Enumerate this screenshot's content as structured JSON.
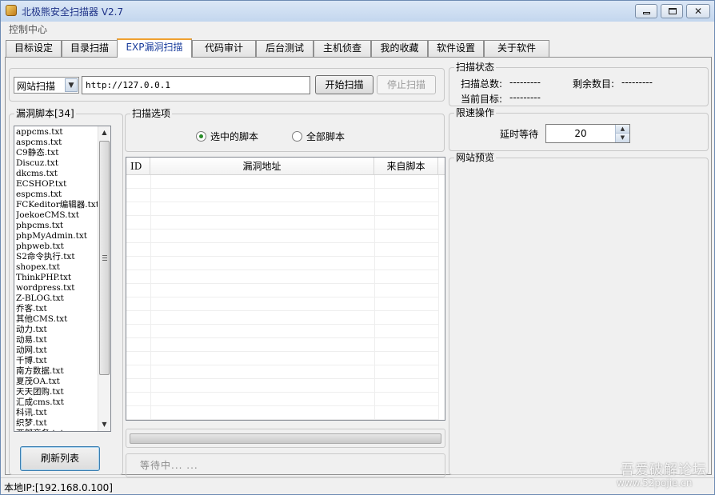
{
  "window": {
    "title": "北极熊安全扫描器 V2.7",
    "buttons": {
      "min": "minimize",
      "max": "maximize",
      "close": "✕"
    }
  },
  "menu": {
    "control_center": "控制中心"
  },
  "tabs": [
    {
      "label": "目标设定"
    },
    {
      "label": "目录扫描"
    },
    {
      "label": "EXP漏洞扫描"
    },
    {
      "label": "代码审计"
    },
    {
      "label": "后台测试"
    },
    {
      "label": "主机侦查"
    },
    {
      "label": "我的收藏"
    },
    {
      "label": "软件设置"
    },
    {
      "label": "关于软件"
    }
  ],
  "active_tab": 2,
  "scan_bar": {
    "mode_value": "网站扫描",
    "url_value": "http://127.0.0.1",
    "start_label": "开始扫描",
    "stop_label": "停止扫描"
  },
  "script_list": {
    "title": "漏洞脚本[34]",
    "items": [
      "appcms.txt",
      "aspcms.txt",
      "C9静态.txt",
      "Discuz.txt",
      "dkcms.txt",
      "ECSHOP.txt",
      "espcms.txt",
      "FCKeditor编辑器.txt",
      "JoekoeCMS.txt",
      "phpcms.txt",
      "phpMyAdmin.txt",
      "phpweb.txt",
      "S2命令执行.txt",
      "shopex.txt",
      "ThinkPHP.txt",
      "wordpress.txt",
      "Z-BLOG.txt",
      "乔客.txt",
      "其他CMS.txt",
      "动力.txt",
      "动易.txt",
      "动网.txt",
      "千博.txt",
      "南方数据.txt",
      "夏茂OA.txt",
      "天天团购.txt",
      "汇成cms.txt",
      "科讯.txt",
      "织梦.txt",
      "西部商务.txt"
    ],
    "refresh_label": "刷新列表"
  },
  "scan_options": {
    "title": "扫描选项",
    "selected_label": "选中的脚本",
    "all_label": "全部脚本",
    "selected": "selected"
  },
  "results_table": {
    "columns": [
      "ID",
      "漏洞地址",
      "来自脚本"
    ],
    "rows": []
  },
  "progress": {
    "value": 0
  },
  "wait_text": "等待中... ...",
  "scan_status": {
    "title": "扫描状态",
    "total_label": "扫描总数:",
    "total_value": "---------",
    "remaining_label": "剩余数目:",
    "remaining_value": "---------",
    "current_label": "当前目标:",
    "current_value": "---------"
  },
  "rate_limit": {
    "title": "限速操作",
    "delay_label": "延时等待",
    "delay_value": "20"
  },
  "preview": {
    "title": "网站预览"
  },
  "statusbar": {
    "local_ip": "本地IP:[192.168.0.100]"
  },
  "watermark": {
    "line1": "吾爱破解论坛",
    "line2": "www.52pojie.cn"
  }
}
